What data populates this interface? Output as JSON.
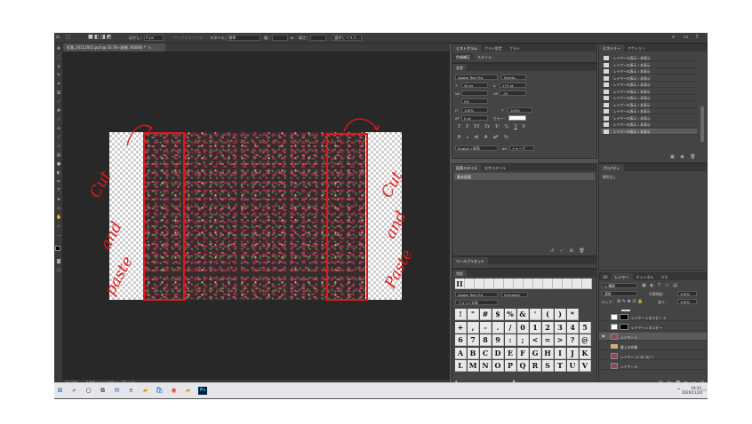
{
  "optbar": {
    "feather_label": "ぼかし：",
    "feather_value": "0 px",
    "antialias": "アンチエイリアス",
    "style_label": "スタイル：",
    "style_value": "標準",
    "width_label": "幅：",
    "height_label": "高さ：",
    "select_mask": "選択とマスク..."
  },
  "document": {
    "tab_title": "紅葉_20112001.psd @ 33.3% (画像, RGB/8) *",
    "zoom": "33.33%",
    "doc_size": "1366 px x 1440 px (72 ppi)"
  },
  "annotations": {
    "left": [
      "Cut",
      "and",
      "paste"
    ],
    "right": [
      "Cut",
      "and",
      "Paste"
    ]
  },
  "panels": {
    "group1_tabs": [
      "ヒストグラム",
      "ブラシ設定",
      "ブラシ"
    ],
    "group2_tabs": [
      "色調補正",
      "スタイル"
    ],
    "character_tab": "文字",
    "font_family": "Adobe Text Pro",
    "font_style": "Semib...",
    "font_size": "40 pt",
    "leading": "175 pt",
    "kerning": "",
    "tracking": "-25",
    "tsume": "0%",
    "vscale": "100%",
    "hscale": "100%",
    "baseline": "0 pt",
    "color_label": "カラー：",
    "type_buttons": [
      "T",
      "T",
      "TT",
      "Tr",
      "T¹",
      "T₁",
      "T",
      "T̶"
    ],
    "lang": "English (米国)",
    "aa_label": "aa",
    "aa_value": "シャープ",
    "para_tabs": [
      "段落スタイル",
      "文字スタイル"
    ],
    "para_default": "基本段落",
    "tool_preset_tab": "ツールプリセット",
    "glyph_tab": "字形",
    "glyph_font": "Adobe Text Pro",
    "glyph_style": "Semibold",
    "glyph_filter": "フォント全体",
    "glyphs": [
      [
        "!",
        "\"",
        "#",
        "$",
        "%",
        "&",
        "'",
        "(",
        ")",
        "*"
      ],
      [
        "+",
        ",",
        "-",
        ".",
        "/",
        "0",
        "1",
        "2",
        "3",
        "4",
        "5"
      ],
      [
        "6",
        "7",
        "8",
        "9",
        ":",
        ";",
        "<",
        "=",
        ">",
        "?",
        "@"
      ],
      [
        "A",
        "B",
        "C",
        "D",
        "E",
        "F",
        "G",
        "H",
        "I",
        "J",
        "K"
      ],
      [
        "L",
        "M",
        "N",
        "O",
        "P",
        "Q",
        "R",
        "S",
        "T",
        "U",
        "V"
      ]
    ],
    "history_tabs": [
      "ヒストリー",
      "アクション"
    ],
    "history_items": [
      "レイヤーの表示 / 非表示",
      "レイヤーの表示 / 非表示",
      "レイヤーの表示 / 非表示",
      "レイヤーの表示 / 非表示",
      "レイヤーの表示 / 非表示",
      "レイヤーの表示 / 非表示",
      "レイヤーの表示 / 非表示",
      "レイヤーの表示 / 非表示",
      "レイヤーの表示 / 非表示",
      "レイヤーの表示 / 非表示",
      "レイヤーの表示 / 非表示",
      "レイヤーの表示 / 非表示"
    ],
    "properties_tab": "プロパティ",
    "properties_text": "属性なし",
    "layers_tabs": [
      "3D",
      "レイヤー",
      "チャンネル",
      "パス"
    ],
    "layer_kind": "Q 種類",
    "blend_mode": "通常",
    "opacity_label": "不透明度：",
    "opacity_value": "100%",
    "lock_label": "ロック：",
    "fill_label": "塗り：",
    "fill_value": "100%",
    "layers": [
      "レイヤー 2 のコピー 3",
      "レイヤー 2 のコピー",
      "レイヤー 2",
      "雲上の外観",
      "レイヤー 17 のコピー",
      "レイヤー 8"
    ]
  },
  "taskbar": {
    "time": "19:32",
    "date": "2020/11/20"
  },
  "colors": {
    "annotation": "#e0191b",
    "ps_bg": "#535353",
    "canvas_bg": "#282828"
  }
}
